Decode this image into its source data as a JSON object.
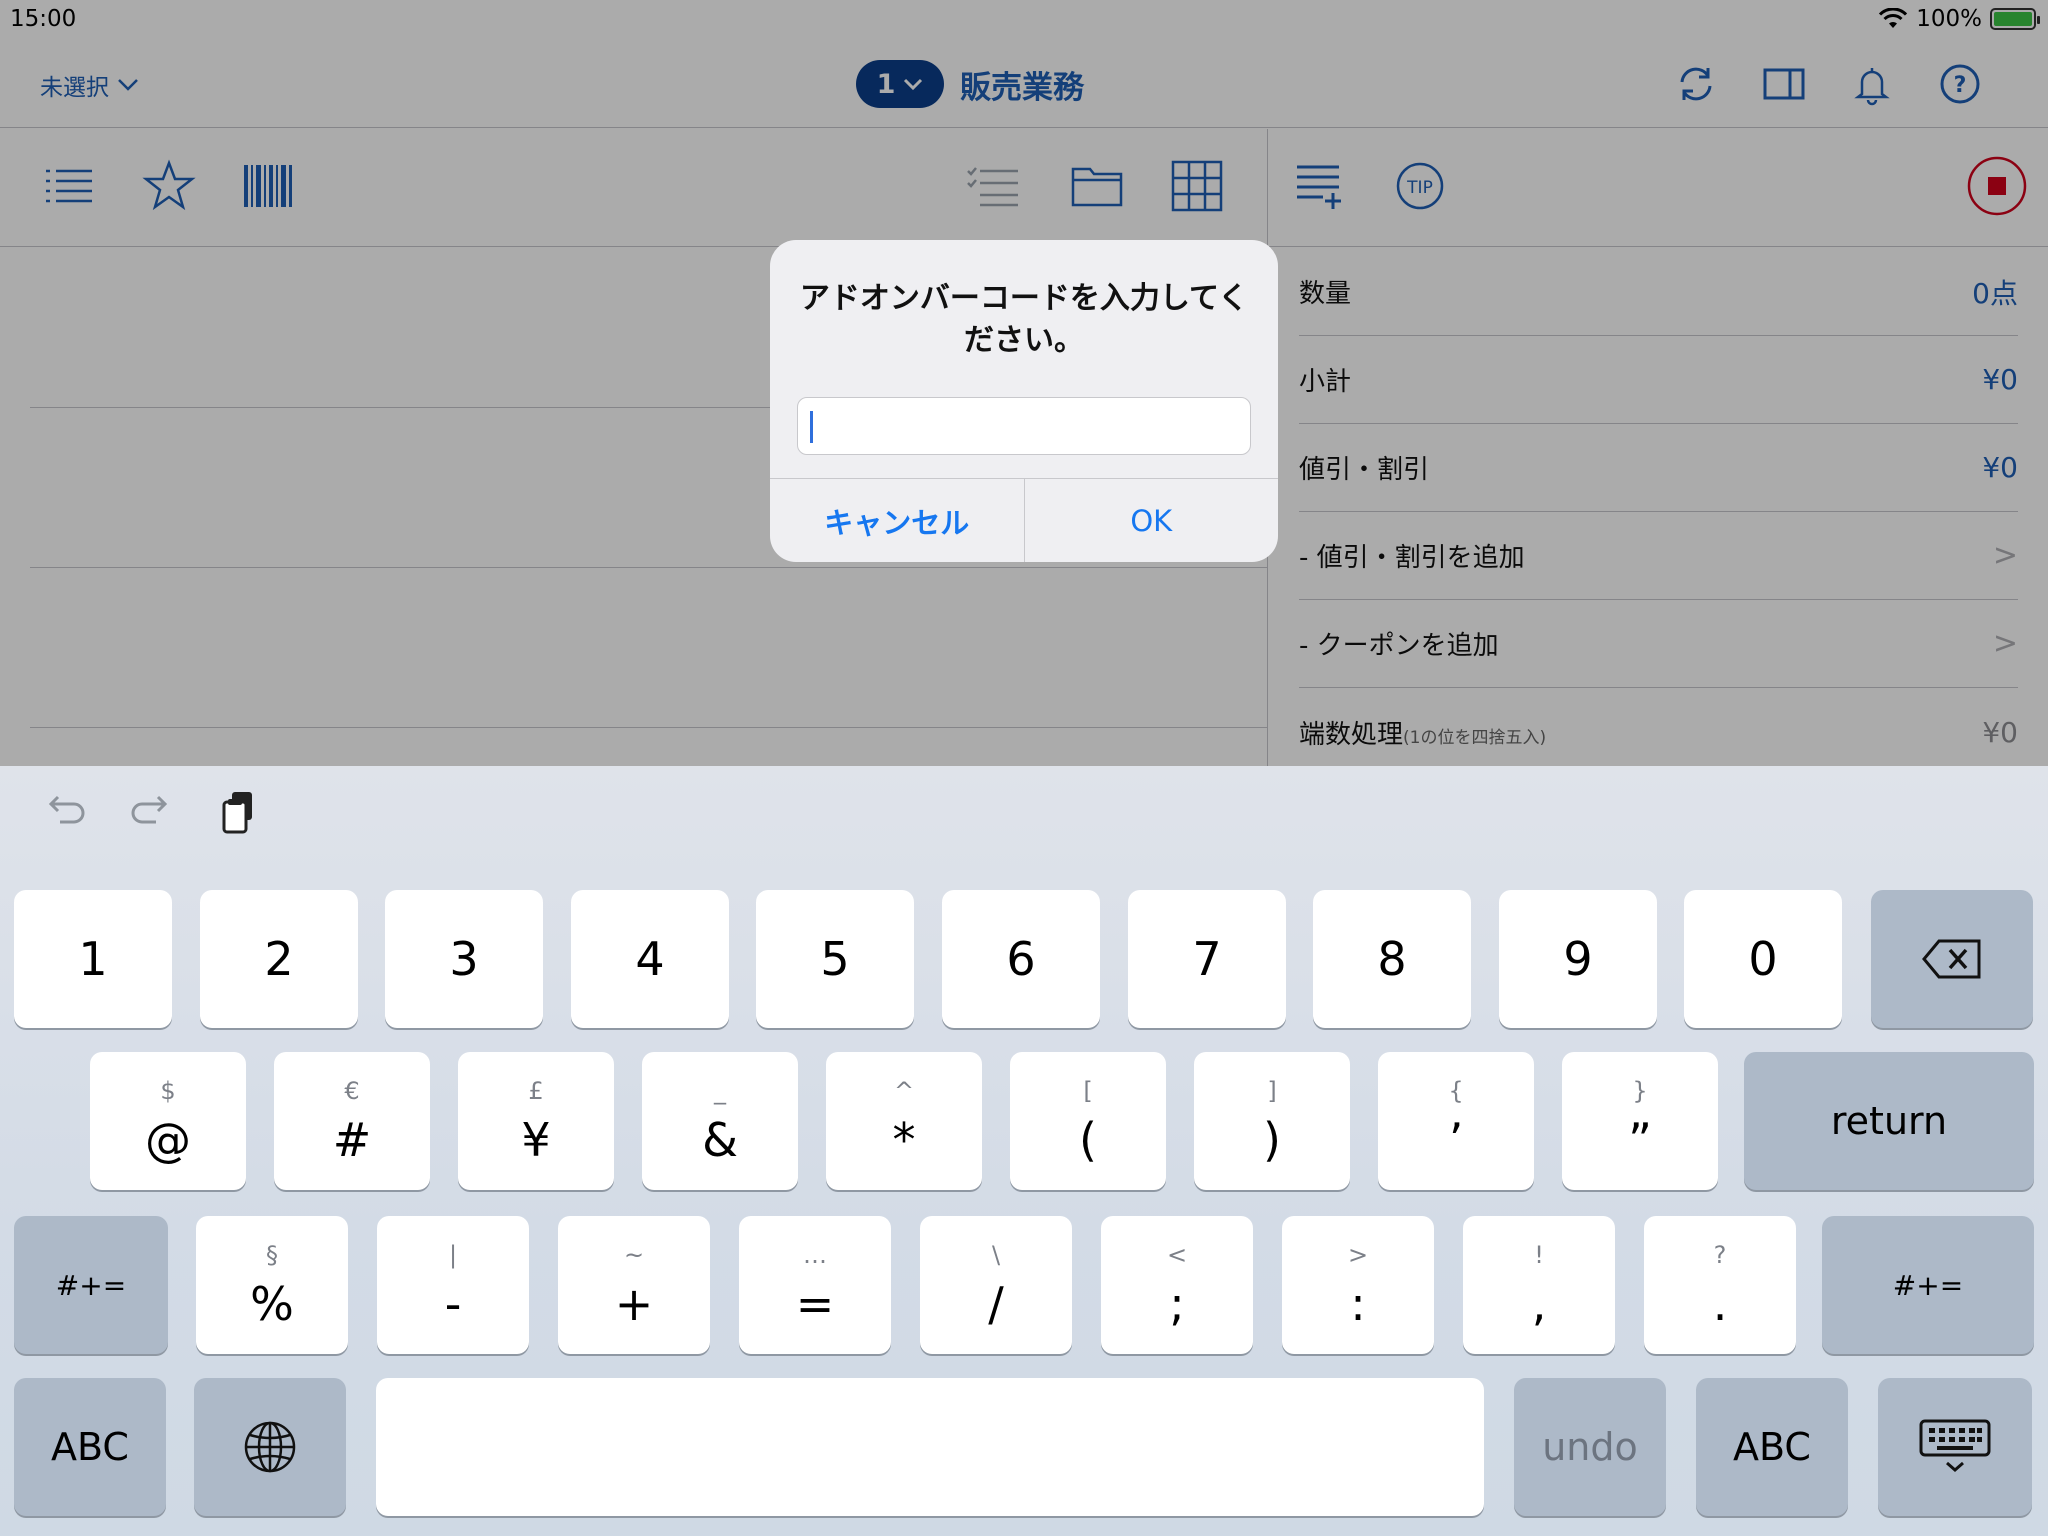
{
  "status_bar": {
    "time": "15:00",
    "battery": "100%",
    "battery_level": 1.0
  },
  "nav": {
    "selector_label": "未選択",
    "register_number": "1",
    "title": "販売業務"
  },
  "summary": {
    "rows": [
      {
        "label": "数量",
        "value": "0点"
      },
      {
        "label": "小計",
        "value": "¥0"
      },
      {
        "label": "値引・割引",
        "value": "¥0"
      },
      {
        "label": "- 値引・割引を追加",
        "value": ">"
      },
      {
        "label": "- クーポンを追加",
        "value": ">"
      },
      {
        "label": "端数処理",
        "sub": "(1の位を四捨五入)",
        "value": "¥0"
      }
    ]
  },
  "alert": {
    "title": "アドオンバーコードを入力してください。",
    "input_value": "",
    "cancel_label": "キャンセル",
    "ok_label": "OK"
  },
  "keyboard": {
    "row1": [
      "1",
      "2",
      "3",
      "4",
      "5",
      "6",
      "7",
      "8",
      "9",
      "0"
    ],
    "row2": [
      {
        "alt": "$",
        "main": "@"
      },
      {
        "alt": "€",
        "main": "#"
      },
      {
        "alt": "£",
        "main": "¥"
      },
      {
        "alt": "_",
        "main": "&"
      },
      {
        "alt": "^",
        "main": "*"
      },
      {
        "alt": "[",
        "main": "("
      },
      {
        "alt": "]",
        "main": ")"
      },
      {
        "alt": "{",
        "main": "’"
      },
      {
        "alt": "}",
        "main": "”"
      }
    ],
    "return_label": "return",
    "row3": [
      {
        "alt": "§",
        "main": "%"
      },
      {
        "alt": "|",
        "main": "-"
      },
      {
        "alt": "~",
        "main": "+"
      },
      {
        "alt": "…",
        "main": "="
      },
      {
        "alt": "\\",
        "main": "/"
      },
      {
        "alt": "<",
        "main": ";"
      },
      {
        "alt": ">",
        "main": ":"
      },
      {
        "alt": "!",
        "main": ","
      },
      {
        "alt": "?",
        "main": "."
      }
    ],
    "symbols_label": "#+=",
    "abc_label": "ABC",
    "undo_label": "undo"
  },
  "colors": {
    "accent": "#1f5fb5",
    "alert_button": "#1677f0",
    "stop": "#d0021b"
  }
}
